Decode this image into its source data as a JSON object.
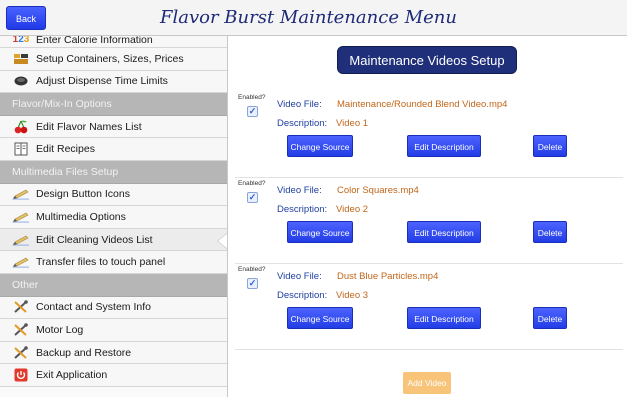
{
  "header": {
    "back_label": "Back",
    "title": "Flavor Burst Maintenance Menu"
  },
  "sidebar": {
    "items": [
      {
        "type": "item",
        "label": "Enter Calorie Information",
        "icon": "calorie-123-icon",
        "partial": true
      },
      {
        "type": "item",
        "label": "Setup Containers, Sizes, Prices",
        "icon": "containers-icon"
      },
      {
        "type": "item",
        "label": "Adjust Dispense Time Limits",
        "icon": "timer-icon"
      },
      {
        "type": "section",
        "label": "Flavor/Mix-In Options"
      },
      {
        "type": "item",
        "label": "Edit Flavor Names List",
        "icon": "cherry-icon"
      },
      {
        "type": "item",
        "label": "Edit Recipes",
        "icon": "recipe-book-icon"
      },
      {
        "type": "section",
        "label": "Multimedia Files Setup"
      },
      {
        "type": "item",
        "label": "Design Button Icons",
        "icon": "pencil-icon"
      },
      {
        "type": "item",
        "label": "Multimedia Options",
        "icon": "pencil-icon"
      },
      {
        "type": "item",
        "label": "Edit Cleaning Videos List",
        "icon": "pencil-icon",
        "active": true
      },
      {
        "type": "item",
        "label": "Transfer files to touch panel",
        "icon": "pencil-icon"
      },
      {
        "type": "section",
        "label": "Other"
      },
      {
        "type": "item",
        "label": "Contact and System Info",
        "icon": "tools-icon"
      },
      {
        "type": "item",
        "label": "Motor Log",
        "icon": "tools-icon"
      },
      {
        "type": "item",
        "label": "Backup and Restore",
        "icon": "tools-icon"
      },
      {
        "type": "item",
        "label": "Exit Application",
        "icon": "power-icon"
      }
    ]
  },
  "main": {
    "section_title": "Maintenance Videos Setup",
    "enabled_label": "Enabled?",
    "file_key": "Video File:",
    "desc_key": "Description:",
    "buttons": {
      "change": "Change Source",
      "edit": "Edit Description",
      "delete": "Delete"
    },
    "videos": [
      {
        "file": "Maintenance/Rounded Blend Video.mp4",
        "description": "Video 1",
        "enabled": true
      },
      {
        "file": "Color Squares.mp4",
        "description": "Video 2",
        "enabled": true
      },
      {
        "file": "Dust Blue Particles.mp4",
        "description": "Video 3",
        "enabled": true
      }
    ],
    "add_label": "Add Video"
  },
  "colors": {
    "accent": "#223de6",
    "title_bg": "#1f2f7a",
    "section_bg": "#b6b6b6",
    "value_text": "#c2661a",
    "key_text": "#1f3fa0",
    "add_button": "#f7c47a"
  }
}
